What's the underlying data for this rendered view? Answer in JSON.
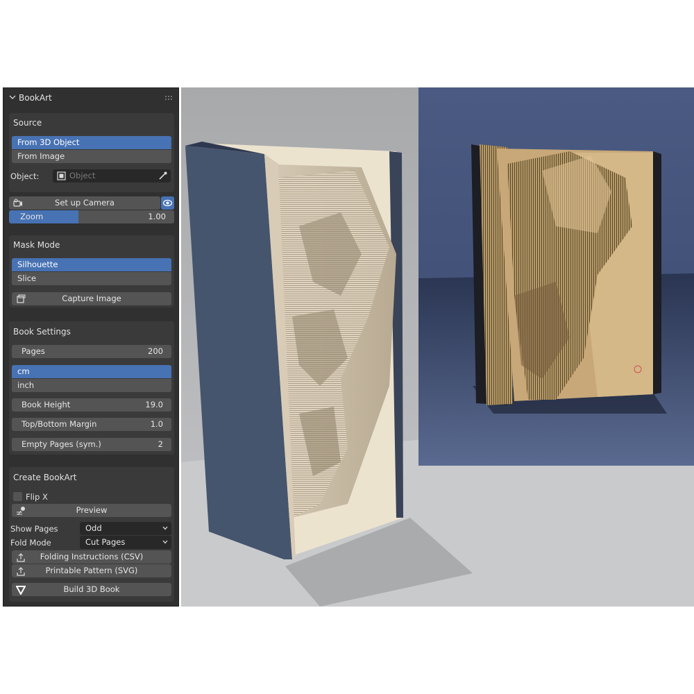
{
  "panel": {
    "title": "BookArt",
    "source": {
      "heading": "Source",
      "options": [
        "From 3D Object",
        "From Image"
      ],
      "selected": "From 3D Object",
      "object_label": "Object:",
      "object_placeholder": "Object"
    },
    "camera": {
      "setup_label": "Set up Camera",
      "zoom_label": "Zoom",
      "zoom_value": "1.00",
      "zoom_fraction": 0.42
    },
    "mask": {
      "heading": "Mask Mode",
      "options": [
        "Silhouette",
        "Slice"
      ],
      "selected": "Silhouette",
      "capture_label": "Capture Image"
    },
    "book": {
      "heading": "Book Settings",
      "pages_label": "Pages",
      "pages_value": "200",
      "units": [
        "cm",
        "inch"
      ],
      "selected_unit": "cm",
      "height_label": "Book Height",
      "height_value": "19.0",
      "margin_label": "Top/Bottom Margin",
      "margin_value": "1.0",
      "empty_label": "Empty Pages (sym.)",
      "empty_value": "2"
    },
    "create": {
      "heading": "Create BookArt",
      "flip_label": "Flip X",
      "preview_label": "Preview",
      "show_pages_label": "Show Pages",
      "show_pages_value": "Odd",
      "fold_mode_label": "Fold Mode",
      "fold_mode_value": "Cut Pages",
      "csv_label": "Folding Instructions (CSV)",
      "svg_label": "Printable Pattern (SVG)",
      "build_label": "Build 3D Book"
    }
  },
  "colors": {
    "panel_bg": "#303030",
    "box_bg": "#3a3a3a",
    "widget_bg": "#545454",
    "accent": "#4772b3",
    "text": "#e6e6e6"
  }
}
